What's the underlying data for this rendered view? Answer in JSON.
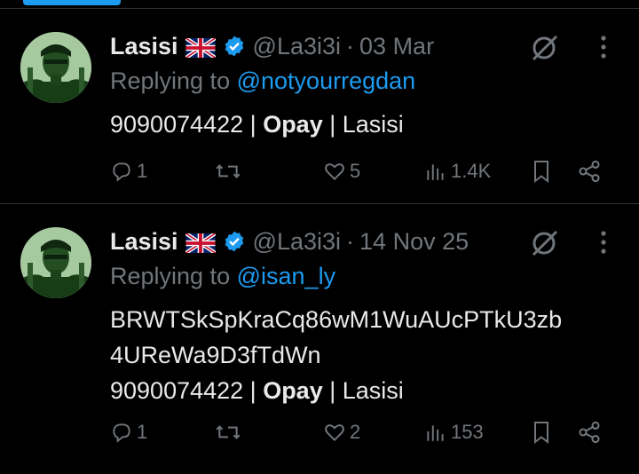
{
  "tweets": [
    {
      "author_name": "Lasisi",
      "flag_icon": "uk-flag-icon",
      "handle": "@La3i3i",
      "separator": "·",
      "date": "03 Mar",
      "replying_prefix": "Replying to",
      "replying_to": "@notyourregdan",
      "body_lines": [
        {
          "parts": [
            "9090074422 | ",
            "Opay",
            " | Lasisi"
          ]
        }
      ],
      "replies": "1",
      "retweets": "",
      "likes": "5",
      "views": "1.4K"
    },
    {
      "author_name": "Lasisi",
      "flag_icon": "uk-flag-icon",
      "handle": "@La3i3i",
      "separator": "·",
      "date": "14 Nov 25",
      "replying_prefix": "Replying to",
      "replying_to": "@isan_ly",
      "body_lines": [
        {
          "text": "BRWTSkSpKraCq86wM1WuAUcPTkU3zb"
        },
        {
          "text": "4UReWa9D3fTdWn"
        },
        {
          "parts": [
            "9090074422 | ",
            "Opay",
            " | Lasisi"
          ]
        }
      ],
      "replies": "1",
      "retweets": "",
      "likes": "2",
      "views": "153"
    }
  ],
  "colors": {
    "accent": "#1d9bf0",
    "muted": "#71767b",
    "text": "#e7e9ea",
    "background": "#000000"
  }
}
